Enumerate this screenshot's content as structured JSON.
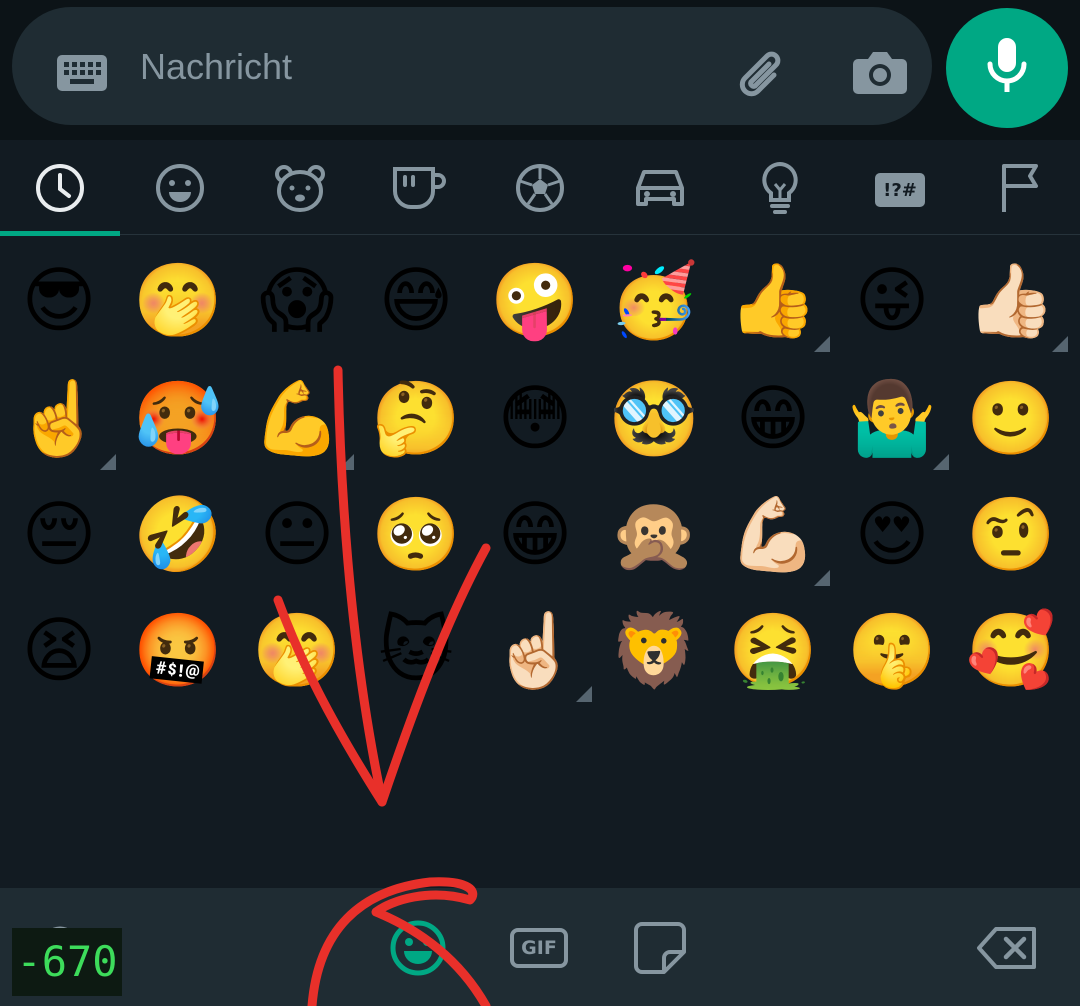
{
  "message_bar": {
    "placeholder": "Nachricht",
    "keyboard_icon": "keyboard-icon",
    "attach_icon": "paperclip-icon",
    "camera_icon": "camera-icon",
    "mic_icon": "microphone-icon",
    "mic_button_color": "#00a884"
  },
  "emoji_tabs": {
    "active_index": 0,
    "active_color": "#00a884",
    "items": [
      {
        "icon": "clock-icon"
      },
      {
        "icon": "smiley-icon"
      },
      {
        "icon": "bear-icon"
      },
      {
        "icon": "cup-icon"
      },
      {
        "icon": "soccer-ball-icon"
      },
      {
        "icon": "car-icon"
      },
      {
        "icon": "lightbulb-icon"
      },
      {
        "icon": "symbols-icon",
        "label": "!?#"
      },
      {
        "icon": "flag-icon"
      }
    ]
  },
  "emoji_grid": {
    "rows": [
      [
        {
          "e": "😎"
        },
        {
          "e": "🤭"
        },
        {
          "e": "😱"
        },
        {
          "e": "😅"
        },
        {
          "e": "🤪"
        },
        {
          "e": "🥳"
        },
        {
          "e": "👍",
          "variants": true
        },
        {
          "e": "😜"
        },
        {
          "e": "👍🏻",
          "variants": true
        }
      ],
      [
        {
          "e": "☝️",
          "variants": true
        },
        {
          "e": "🥵"
        },
        {
          "e": "💪",
          "variants": true
        },
        {
          "e": "🤔"
        },
        {
          "e": "😳"
        },
        {
          "e": "🥸"
        },
        {
          "e": "😁"
        },
        {
          "e": "🤷‍♂️",
          "variants": true
        },
        {
          "e": "🙂"
        }
      ],
      [
        {
          "e": "😔"
        },
        {
          "e": "🤣"
        },
        {
          "e": "😐"
        },
        {
          "e": "🥺"
        },
        {
          "e": "😁"
        },
        {
          "e": "🙊"
        },
        {
          "e": "💪🏻",
          "variants": true
        },
        {
          "e": "😍"
        },
        {
          "e": "🤨"
        }
      ],
      [
        {
          "e": "😫"
        },
        {
          "e": "🤬"
        },
        {
          "e": "🤭"
        },
        {
          "e": "🐱"
        },
        {
          "e": "☝🏻",
          "variants": true
        },
        {
          "e": "🦁"
        },
        {
          "e": "🤮"
        },
        {
          "e": "🤫"
        },
        {
          "e": "🥰"
        }
      ]
    ]
  },
  "bottom_bar": {
    "counter": "-670",
    "search_icon": "search-icon",
    "emoji_icon": "emoji-icon",
    "gif_label": "GIF",
    "sticker_icon": "sticker-icon",
    "backspace_icon": "backspace-icon",
    "active_color": "#00a884"
  },
  "annotation_color": "#e8302a"
}
